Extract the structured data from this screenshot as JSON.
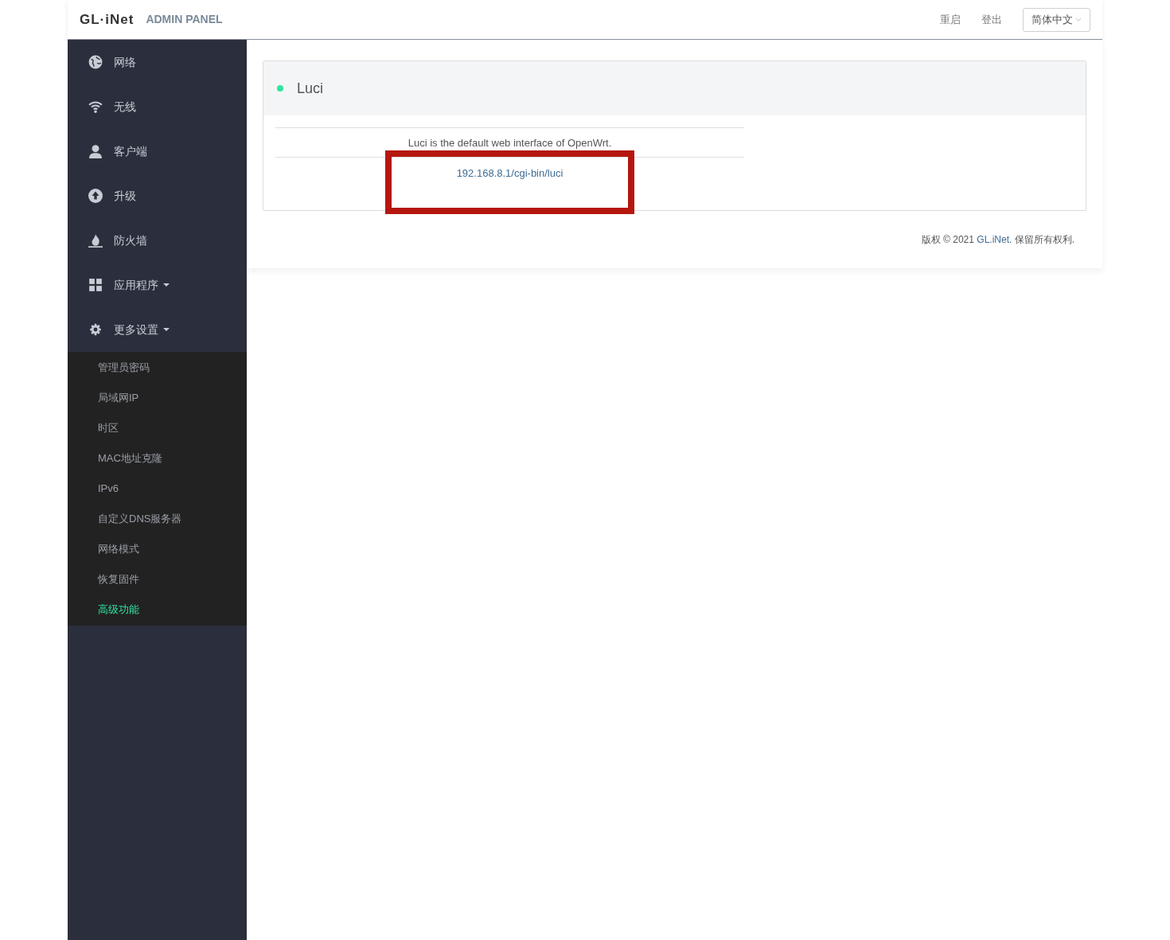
{
  "header": {
    "logo": "GL·iNet",
    "subtitle": "ADMIN PANEL",
    "actions": [
      "重启",
      "登出"
    ],
    "language": "简体中文"
  },
  "sidebar": {
    "items": [
      {
        "label": "网络",
        "dropdown": false
      },
      {
        "label": "无线",
        "dropdown": false
      },
      {
        "label": "客户端",
        "dropdown": false
      },
      {
        "label": "升级",
        "dropdown": false
      },
      {
        "label": "防火墙",
        "dropdown": false
      },
      {
        "label": "应用程序",
        "dropdown": true,
        "expanded": false
      },
      {
        "label": "更多设置",
        "dropdown": true,
        "expanded": true,
        "children": [
          {
            "label": "管理员密码",
            "selected": false
          },
          {
            "label": "局域网IP",
            "selected": false
          },
          {
            "label": "时区",
            "selected": false
          },
          {
            "label": "MAC地址克隆",
            "selected": false
          },
          {
            "label": "IPv6",
            "selected": false
          },
          {
            "label": "自定义DNS服务器",
            "selected": false
          },
          {
            "label": "网络模式",
            "selected": false
          },
          {
            "label": "恢复固件",
            "selected": false
          },
          {
            "label": "高级功能",
            "selected": true
          }
        ]
      }
    ]
  },
  "panel": {
    "title": "Luci",
    "description": "Luci is the default web interface of OpenWrt.",
    "link": "192.168.8.1/cgi-bin/luci",
    "highlighted": true
  },
  "footer": {
    "before": "版权 © 2021 ",
    "link": "GL.iNet.",
    "after": " 保留所有权利."
  }
}
